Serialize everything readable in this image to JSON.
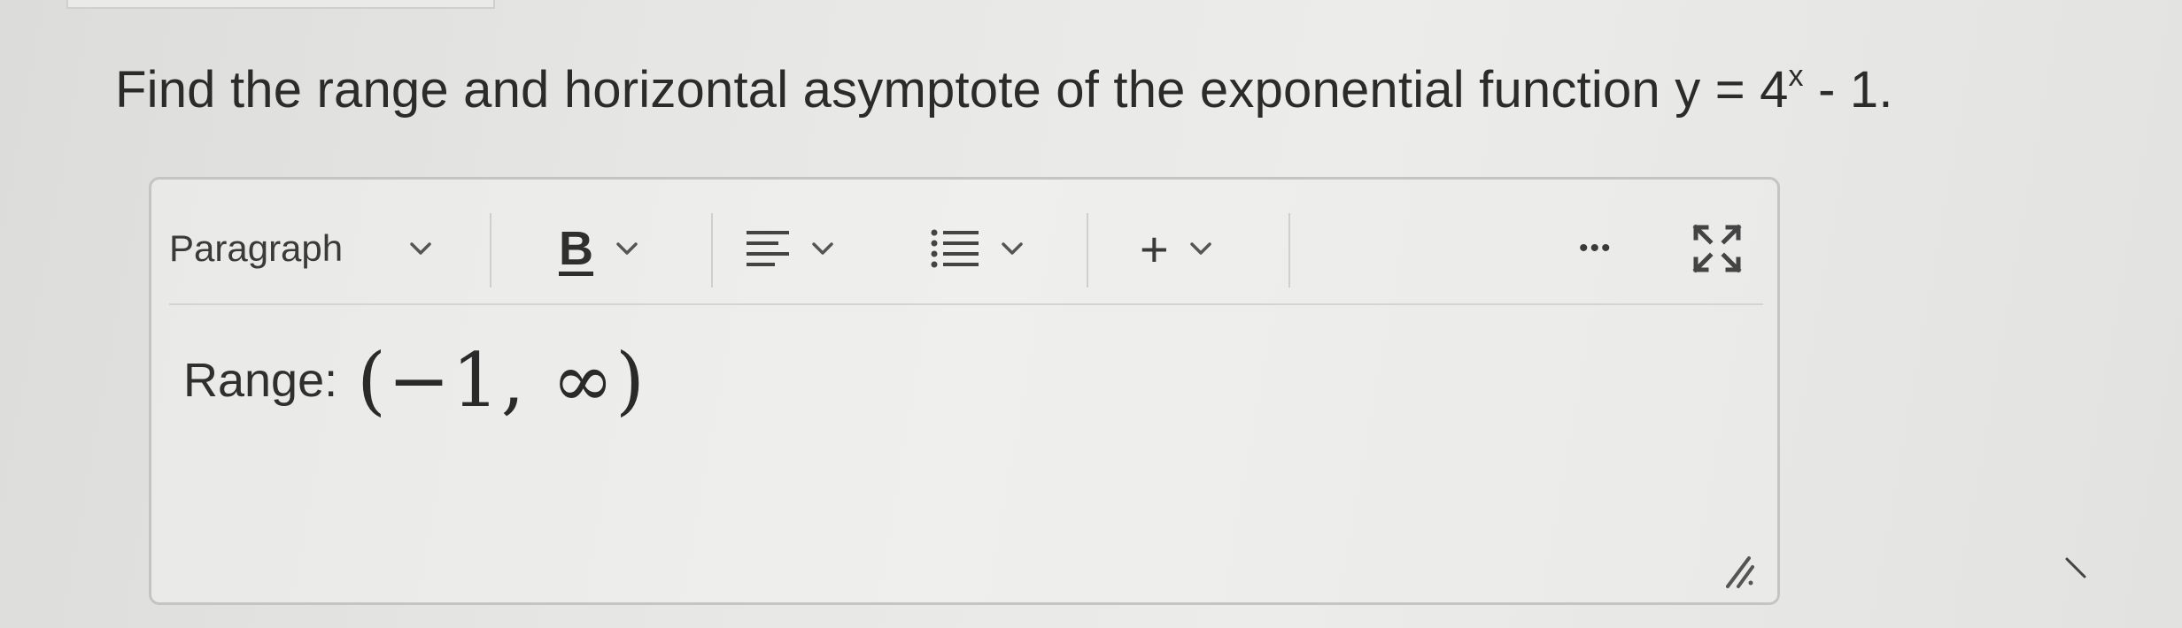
{
  "question": {
    "text": "Find the range and horizontal asymptote of the exponential function y = 4",
    "exponent": "x",
    "tail": " - 1."
  },
  "toolbar": {
    "block_format": "Paragraph",
    "bold": "B",
    "insert": "+",
    "more": "•••"
  },
  "icons": {
    "bold": "bold-icon",
    "align": "align-icon",
    "list": "list-icon",
    "insert": "plus-icon",
    "more": "more-icon",
    "fullscreen": "fullscreen-icon",
    "resize": "resize-handle-icon"
  },
  "content": {
    "label": "Range:",
    "value": "(−1, ∞)"
  }
}
